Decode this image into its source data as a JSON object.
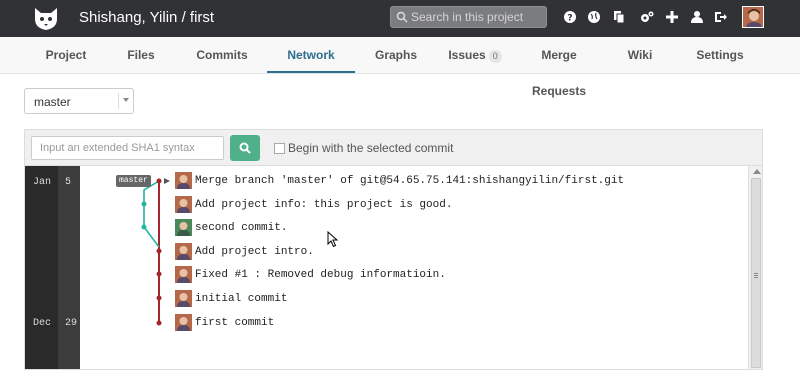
{
  "header": {
    "title": "Shishang, Yilin / first",
    "search_placeholder": "Search in this project",
    "icons": [
      "help-icon",
      "globe-icon",
      "copy-icon",
      "gears-icon",
      "plus-icon",
      "user-icon",
      "logout-icon"
    ]
  },
  "nav": {
    "tabs": [
      {
        "label": "Project"
      },
      {
        "label": "Files"
      },
      {
        "label": "Commits"
      },
      {
        "label": "Network",
        "active": true
      },
      {
        "label": "Graphs"
      },
      {
        "label": "Issues",
        "count": "0"
      },
      {
        "label": "Merge Requests"
      },
      {
        "label": "Wiki"
      },
      {
        "label": "Settings"
      }
    ]
  },
  "branch_select": {
    "value": "master"
  },
  "filter": {
    "sha_placeholder": "Input an extended SHA1 syntax",
    "checkbox_label": "Begin with the selected commit"
  },
  "graph": {
    "branch_tag": "master",
    "dates": [
      {
        "month": "Jan",
        "day": "5"
      },
      {
        "month": "Dec",
        "day": "29"
      }
    ],
    "commits": [
      {
        "message": "Merge branch 'master' of git@54.65.75.141:shishangyilin/first.git"
      },
      {
        "message": "Add project info: this project is good."
      },
      {
        "message": "second commit."
      },
      {
        "message": "Add project intro."
      },
      {
        "message": "Fixed #1 : Removed debug informatioin."
      },
      {
        "message": "initial commit"
      },
      {
        "message": "first commit"
      }
    ],
    "colors": {
      "main_line": "#a4262c",
      "side_line": "#24b4a0"
    }
  }
}
